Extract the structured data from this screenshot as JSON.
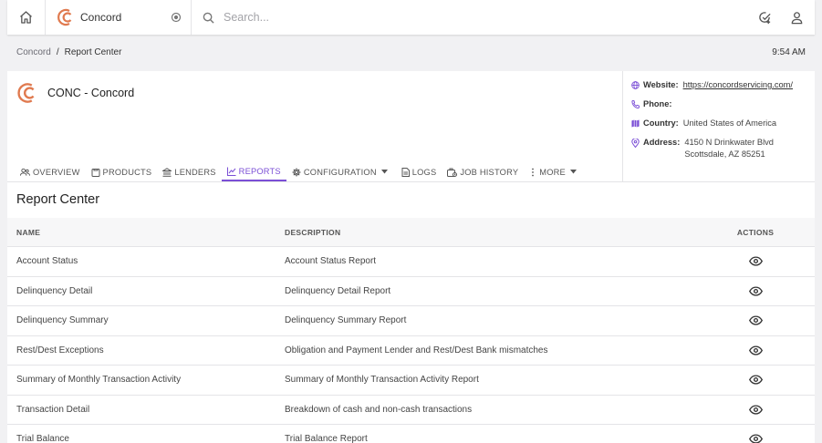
{
  "topbar": {
    "company_name": "Concord",
    "search_placeholder": "Search..."
  },
  "breadcrumb": {
    "parent": "Concord",
    "separator": "/",
    "current": "Report Center"
  },
  "time": "9:54 AM",
  "company": {
    "title": "CONC - Concord",
    "website_label": "Website:",
    "website": "https://concordservicing.com/",
    "phone_label": "Phone:",
    "phone": "",
    "country_label": "Country:",
    "country": "United States of America",
    "address_label": "Address:",
    "address_line1": "4150 N Drinkwater Blvd",
    "address_line2": "Scottsdale, AZ 85251"
  },
  "tabs": [
    {
      "label": "OVERVIEW",
      "icon": "users-icon"
    },
    {
      "label": "PRODUCTS",
      "icon": "clipboard-icon"
    },
    {
      "label": "LENDERS",
      "icon": "bank-icon"
    },
    {
      "label": "REPORTS",
      "icon": "chart-line-icon",
      "active": true
    },
    {
      "label": "CONFIGURATION",
      "icon": "gear-icon"
    },
    {
      "label": "LOGS",
      "icon": "document-icon"
    },
    {
      "label": "JOB HISTORY",
      "icon": "job-icon"
    },
    {
      "label": "MORE",
      "icon": "more-vertical-icon"
    }
  ],
  "report_center": {
    "title": "Report Center",
    "columns": {
      "name": "NAME",
      "description": "DESCRIPTION",
      "actions": "ACTIONS"
    },
    "rows": [
      {
        "name": "Account Status",
        "description": "Account Status Report"
      },
      {
        "name": "Delinquency Detail",
        "description": "Delinquency Detail Report"
      },
      {
        "name": "Delinquency Summary",
        "description": "Delinquency Summary Report"
      },
      {
        "name": "Rest/Dest Exceptions",
        "description": "Obligation and Payment Lender and Rest/Dest Bank mismatches"
      },
      {
        "name": "Summary of Monthly Transaction Activity",
        "description": "Summary of Monthly Transaction Activity Report"
      },
      {
        "name": "Transaction Detail",
        "description": "Breakdown of cash and non-cash transactions"
      },
      {
        "name": "Trial Balance",
        "description": "Trial Balance Report"
      }
    ]
  },
  "colors": {
    "accent": "#7b4fd6",
    "logo": "#e07a4f"
  }
}
